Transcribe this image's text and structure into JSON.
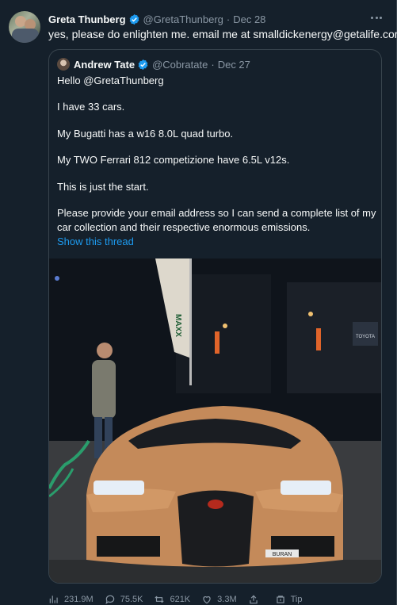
{
  "tweet": {
    "author_name": "Greta Thunberg",
    "author_handle": "@GretaThunberg",
    "date": "Dec 28",
    "text": "yes, please do enlighten me. email me at smalldickenergy@getalife.com"
  },
  "quoted_tweet": {
    "author_name": "Andrew Tate",
    "author_handle": "@Cobratate",
    "date": "Dec 27",
    "lines": [
      "Hello @GretaThunberg",
      "I have 33 cars.",
      "My Bugatti has a w16 8.0L quad turbo.",
      "My TWO Ferrari 812 competizione have 6.5L v12s.",
      "This is just the start.",
      "Please provide your email address so I can send a complete list of my",
      "car collection and their respective enormous emissions."
    ],
    "show_thread": "Show this thread",
    "photo": {
      "banner_text": "MAXX",
      "plate_text": "BURAN",
      "brand_badge": "TOYOTA"
    }
  },
  "actions": {
    "views": "231.9M",
    "replies": "75.5K",
    "retweets": "621K",
    "likes": "3.3M",
    "tip": "Tip"
  },
  "colors": {
    "background": "#15202b",
    "border": "#38444d",
    "muted": "#8b98a5",
    "link": "#1d9bf0",
    "verified": "#1d9bf0"
  },
  "icons": [
    "more-icon",
    "verified-icon",
    "views-icon",
    "reply-icon",
    "retweet-icon",
    "like-icon",
    "share-icon",
    "tip-icon"
  ]
}
